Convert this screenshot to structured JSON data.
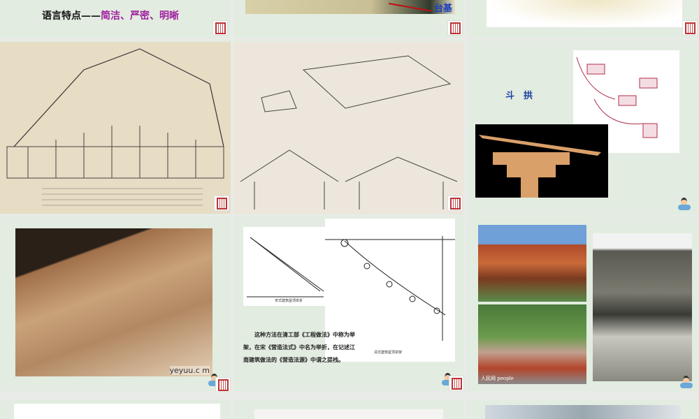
{
  "slides": [
    {
      "id": 1,
      "title_prefix": "语言特点——",
      "title_emphasis": "简洁、严密、明晰"
    },
    {
      "id": 2,
      "label": "台基"
    },
    {
      "id": 3
    },
    {
      "id": 4
    },
    {
      "id": 5
    },
    {
      "id": 6,
      "title": "斗　拱"
    },
    {
      "id": 7,
      "watermark": "yeyuu.c m"
    },
    {
      "id": 8,
      "paragraph": "这种方法在清工部《工程做法》中称为举架，在宋《营造法式》中名为举折，在记述江南建筑做法的《营造法源》中谓之提栈。",
      "caption_left": "宋式建筑屋顶举折",
      "caption_right": "清式建筑屋顶举架"
    },
    {
      "id": 9,
      "watermark": "人民网 people"
    }
  ],
  "colors": {
    "slide_bg": "#e3ece0",
    "title_accent": "#a020a0",
    "label_blue": "#1a3fc0",
    "dougong_blue": "#1a3fa0"
  }
}
